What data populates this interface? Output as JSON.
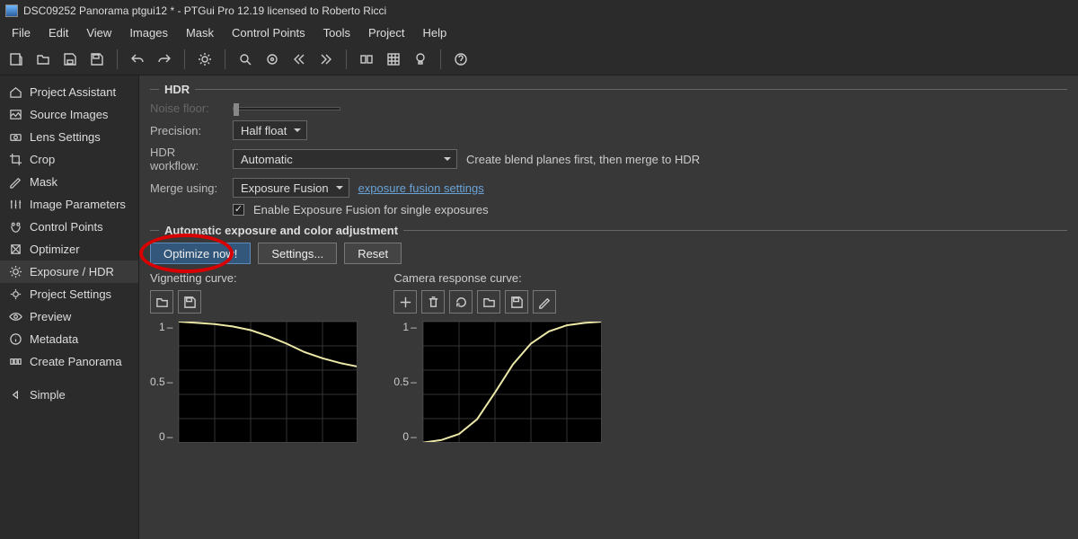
{
  "window": {
    "title": "DSC09252 Panorama ptgui12 * - PTGui Pro 12.19 licensed to Roberto Ricci"
  },
  "menu": [
    "File",
    "Edit",
    "View",
    "Images",
    "Mask",
    "Control Points",
    "Tools",
    "Project",
    "Help"
  ],
  "sidebar": {
    "items": [
      "Project Assistant",
      "Source Images",
      "Lens Settings",
      "Crop",
      "Mask",
      "Image Parameters",
      "Control Points",
      "Optimizer",
      "Exposure / HDR",
      "Project Settings",
      "Preview",
      "Metadata",
      "Create Panorama"
    ],
    "active_index": 8,
    "simple_label": "Simple"
  },
  "hdr": {
    "section_title": "HDR",
    "noise_floor_label": "Noise floor:",
    "precision_label": "Precision:",
    "precision_value": "Half float",
    "workflow_label": "HDR workflow:",
    "workflow_value": "Automatic",
    "workflow_hint": "Create blend planes first, then merge to HDR",
    "merge_label": "Merge using:",
    "merge_value": "Exposure Fusion",
    "merge_link": "exposure fusion settings",
    "checkbox_label": "Enable Exposure Fusion for single exposures"
  },
  "auto": {
    "section_title": "Automatic exposure and color adjustment",
    "optimize_btn": "Optimize now!",
    "settings_btn": "Settings...",
    "reset_btn": "Reset",
    "vignetting_title": "Vignetting curve:",
    "camera_title": "Camera response curve:",
    "yticks": [
      "1",
      "0.5",
      "0"
    ]
  },
  "chart_data": [
    {
      "type": "line",
      "title": "Vignetting curve",
      "xlim": [
        0,
        1
      ],
      "ylim": [
        0,
        1
      ],
      "x": [
        0.0,
        0.1,
        0.2,
        0.3,
        0.4,
        0.5,
        0.6,
        0.7,
        0.8,
        0.9,
        1.0
      ],
      "y": [
        1.0,
        0.99,
        0.98,
        0.96,
        0.93,
        0.88,
        0.82,
        0.75,
        0.7,
        0.66,
        0.63
      ]
    },
    {
      "type": "line",
      "title": "Camera response curve",
      "xlim": [
        0,
        1
      ],
      "ylim": [
        0,
        1
      ],
      "x": [
        0.0,
        0.1,
        0.2,
        0.3,
        0.4,
        0.5,
        0.6,
        0.7,
        0.8,
        0.9,
        1.0
      ],
      "y": [
        0.01,
        0.03,
        0.08,
        0.2,
        0.42,
        0.65,
        0.82,
        0.92,
        0.97,
        0.99,
        1.0
      ]
    }
  ]
}
